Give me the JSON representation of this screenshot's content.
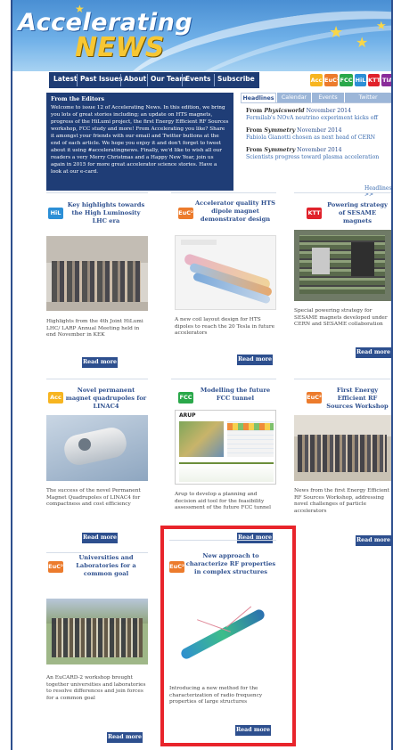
{
  "logo": {
    "line1": "Accelerating",
    "line2": "NEWS"
  },
  "nav": {
    "items": [
      "Latest",
      "Past Issues",
      "About",
      "Our Team",
      "Events",
      "Subscribe"
    ],
    "badges": [
      {
        "label": "Acc",
        "color": "#f7b520"
      },
      {
        "label": "EuC²",
        "color": "#ec7b2c"
      },
      {
        "label": "FCC",
        "color": "#2aa84a"
      },
      {
        "label": "HiL",
        "color": "#2c8fd6"
      },
      {
        "label": "KTT",
        "color": "#e0222b"
      },
      {
        "label": "TIA",
        "color": "#8a2c9a"
      }
    ]
  },
  "editors": {
    "title": "From the Editors",
    "body": "Welcome to issue 12 of Accelerating News. In this edition, we bring you lots of great stories including; an update on HTS magnets, progress of the HiLumi project, the first Energy Efficient RF Sources workshop, FCC study and more! From Accelerating you like? Share it amongst your friends with our email and Twitter buttons at the end of each article. We hope you enjoy it and don't forget to tweet about it using #acceleratingnews. Finally, we'd like to wish all our readers a very Merry Christmas and a Happy New Year, join us again in 2015 for more great accelerator science stories. Have a look at our e-card."
  },
  "tabs": [
    "Headlines",
    "Calendar",
    "Events",
    "Twitter"
  ],
  "headlines": [
    {
      "prefix": "From ",
      "source": "Physicsworld",
      "date": " November 2014",
      "title": "Fermilab's NOvA neutrino experiment kicks off"
    },
    {
      "prefix": "From ",
      "source": "Symmetry",
      "date": " November 2014",
      "title": "Fabiola Gianotti chosen as next head of CERN"
    },
    {
      "prefix": "From ",
      "source": "Symmetry",
      "date": " November 2014",
      "title": "Scientists progress toward plasma acceleration"
    }
  ],
  "headlines_more": "Headlines >>",
  "cards": [
    {
      "icon": "HiL",
      "color": "#2c8fd6",
      "title": "Key highlights towards the High Luminosity LHC era",
      "text": "Highlights from the 4th Joint HiLumi LHC/ LARP Annual Meeting held in end November in KEK",
      "button": "Read more"
    },
    {
      "icon": "EuC²",
      "color": "#ec7b2c",
      "title": "Accelerator quality HTS dipole magnet demonstrator design",
      "text": "A new coil layout design for HTS dipoles to reach the 20 Tesla in future accelerators",
      "button": "Read more"
    },
    {
      "icon": "KTT",
      "color": "#e0222b",
      "title": "Powering strategy of SESAME magnets",
      "text": "Special powering strategy for SESAME magnets developed under CERN and SESAME collaboration",
      "button": "Read more"
    },
    {
      "icon": "Acc",
      "color": "#f7b520",
      "title": "Novel permanent magnet quadrupoles for LINAC4",
      "text": "The success of the novel Permanent Magnet Quadrupoles of LINAC4 for compactness and cost efficiency",
      "button": "Read more"
    },
    {
      "icon": "FCC",
      "color": "#2aa84a",
      "title": "Modelling the future FCC tunnel",
      "text": "Arup to develop a planning and decision aid tool for the feasibility assessment of the future FCC tunnel",
      "button": "Read more",
      "logo": "ARUP"
    },
    {
      "icon": "EuC²",
      "color": "#ec7b2c",
      "title": "First Energy Efficient RF Sources Workshop",
      "text": "News from the first Energy Efficient RF Sources Workshop, addressing novel challenges of particle accelerators",
      "button": "Read more"
    },
    {
      "icon": "EuC²",
      "color": "#ec7b2c",
      "title": "Universities and Laboratories for a common goal",
      "text": "An EuCARD-2 workshop brought together universities and laboratories to resolve differences and join forces for a common goal",
      "button": "Read more"
    },
    {
      "icon": "EuC²",
      "color": "#ec7b2c",
      "title": "New approach to characterize RF properties in complex structures",
      "text": "Introducing a new method for the characterization of radio frequency properties of large structures",
      "button": "Read more"
    }
  ],
  "colors": {
    "brand": "#2d4f8e",
    "highlight": "#e8242b"
  }
}
